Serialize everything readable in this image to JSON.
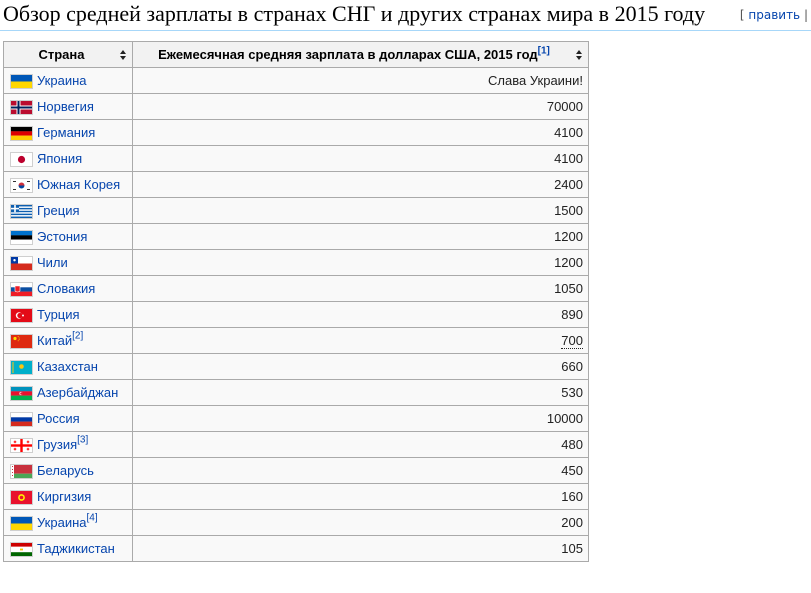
{
  "heading": {
    "title": "Обзор средней зарплаты в странах СНГ и других странах мира в 2015 году",
    "edit_open": "[",
    "edit_label": "править",
    "edit_close": "|"
  },
  "table": {
    "headers": {
      "country": "Страна",
      "salary": "Ежемесячная средняя зарплата в долларах США, 2015 год",
      "salary_ref": "[1]"
    },
    "rows": [
      {
        "flag": "flag-ukraine-icon",
        "country": "Украина",
        "ref": "",
        "value": "Слава Украини!"
      },
      {
        "flag": "flag-norway-icon",
        "country": "Норвегия",
        "ref": "",
        "value": "70000"
      },
      {
        "flag": "flag-germany-icon",
        "country": "Германия",
        "ref": "",
        "value": "4100"
      },
      {
        "flag": "flag-japan-icon",
        "country": "Япония",
        "ref": "",
        "value": "4100"
      },
      {
        "flag": "flag-south-korea-icon",
        "country": "Южная Корея",
        "ref": "",
        "value": "2400"
      },
      {
        "flag": "flag-greece-icon",
        "country": "Греция",
        "ref": "",
        "value": "1500"
      },
      {
        "flag": "flag-estonia-icon",
        "country": "Эстония",
        "ref": "",
        "value": "1200"
      },
      {
        "flag": "flag-chile-icon",
        "country": "Чили",
        "ref": "",
        "value": "1200"
      },
      {
        "flag": "flag-slovakia-icon",
        "country": "Словакия",
        "ref": "",
        "value": "1050"
      },
      {
        "flag": "flag-turkey-icon",
        "country": "Турция",
        "ref": "",
        "value": "890"
      },
      {
        "flag": "flag-china-icon",
        "country": "Китай",
        "ref": "[2]",
        "value": "700"
      },
      {
        "flag": "flag-kazakhstan-icon",
        "country": "Казахстан",
        "ref": "",
        "value": "660"
      },
      {
        "flag": "flag-azerbaijan-icon",
        "country": "Азербайджан",
        "ref": "",
        "value": "530"
      },
      {
        "flag": "flag-russia-icon",
        "country": "Россия",
        "ref": "",
        "value": "10000"
      },
      {
        "flag": "flag-georgia-icon",
        "country": "Грузия",
        "ref": "[3]",
        "value": "480"
      },
      {
        "flag": "flag-belarus-icon",
        "country": "Беларусь",
        "ref": "",
        "value": "450"
      },
      {
        "flag": "flag-kyrgyzstan-icon",
        "country": "Киргизия",
        "ref": "",
        "value": "160"
      },
      {
        "flag": "flag-ukraine-icon",
        "country": "Украина",
        "ref": "[4]",
        "value": "200"
      },
      {
        "flag": "flag-tajikistan-icon",
        "country": "Таджикистан",
        "ref": "",
        "value": "105"
      }
    ]
  },
  "colors": {
    "link": "#0645ad",
    "header_bg": "#f2f2f2",
    "cell_bg": "#f9f9f9",
    "border": "#aaaaaa"
  }
}
